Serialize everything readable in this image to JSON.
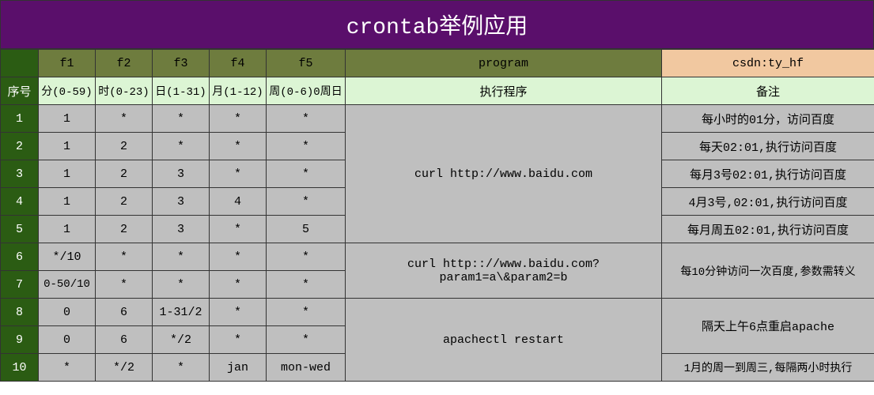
{
  "title": "crontab举例应用",
  "headers1": {
    "f1": "f1",
    "f2": "f2",
    "f3": "f3",
    "f4": "f4",
    "f5": "f5",
    "program": "program",
    "note": "csdn:ty_hf"
  },
  "headers2": {
    "seq": "序号",
    "f1": "分(0-59)",
    "f2": "时(0-23)",
    "f3": "日(1-31)",
    "f4": "月(1-12)",
    "f5": "周(0-6)0周日",
    "program": "执行程序",
    "note": "备注"
  },
  "rows": [
    {
      "n": "1",
      "f1": "1",
      "f2": "*",
      "f3": "*",
      "f4": "*",
      "f5": "*",
      "note": "每小时的01分，访问百度"
    },
    {
      "n": "2",
      "f1": "1",
      "f2": "2",
      "f3": "*",
      "f4": "*",
      "f5": "*",
      "note": "每天02:01,执行访问百度"
    },
    {
      "n": "3",
      "f1": "1",
      "f2": "2",
      "f3": "3",
      "f4": "*",
      "f5": "*",
      "note": "每月3号02:01,执行访问百度"
    },
    {
      "n": "4",
      "f1": "1",
      "f2": "2",
      "f3": "3",
      "f4": "4",
      "f5": "*",
      "note": "4月3号,02:01,执行访问百度"
    },
    {
      "n": "5",
      "f1": "1",
      "f2": "2",
      "f3": "3",
      "f4": "*",
      "f5": "5",
      "note": "每月周五02:01,执行访问百度"
    },
    {
      "n": "6",
      "f1": "*/10",
      "f2": "*",
      "f3": "*",
      "f4": "*",
      "f5": "*",
      "note": "每10分钟访问一次百度,参数需转义"
    },
    {
      "n": "7",
      "f1": "0-50/10",
      "f2": "*",
      "f3": "*",
      "f4": "*",
      "f5": "*",
      "note": ""
    },
    {
      "n": "8",
      "f1": "0",
      "f2": "6",
      "f3": "1-31/2",
      "f4": "*",
      "f5": "*",
      "note": "隔天上午6点重启apache"
    },
    {
      "n": "9",
      "f1": "0",
      "f2": "6",
      "f3": "*/2",
      "f4": "*",
      "f5": "*",
      "note": ""
    },
    {
      "n": "10",
      "f1": "*",
      "f2": "*/2",
      "f3": "*",
      "f4": "jan",
      "f5": "mon-wed",
      "note": "1月的周一到周三,每隔两小时执行"
    }
  ],
  "programs": {
    "p1": "curl http://www.baidu.com",
    "p2": "curl http:://www.baidu.com?param1=a\\&param2=b",
    "p3": "apachectl restart"
  }
}
